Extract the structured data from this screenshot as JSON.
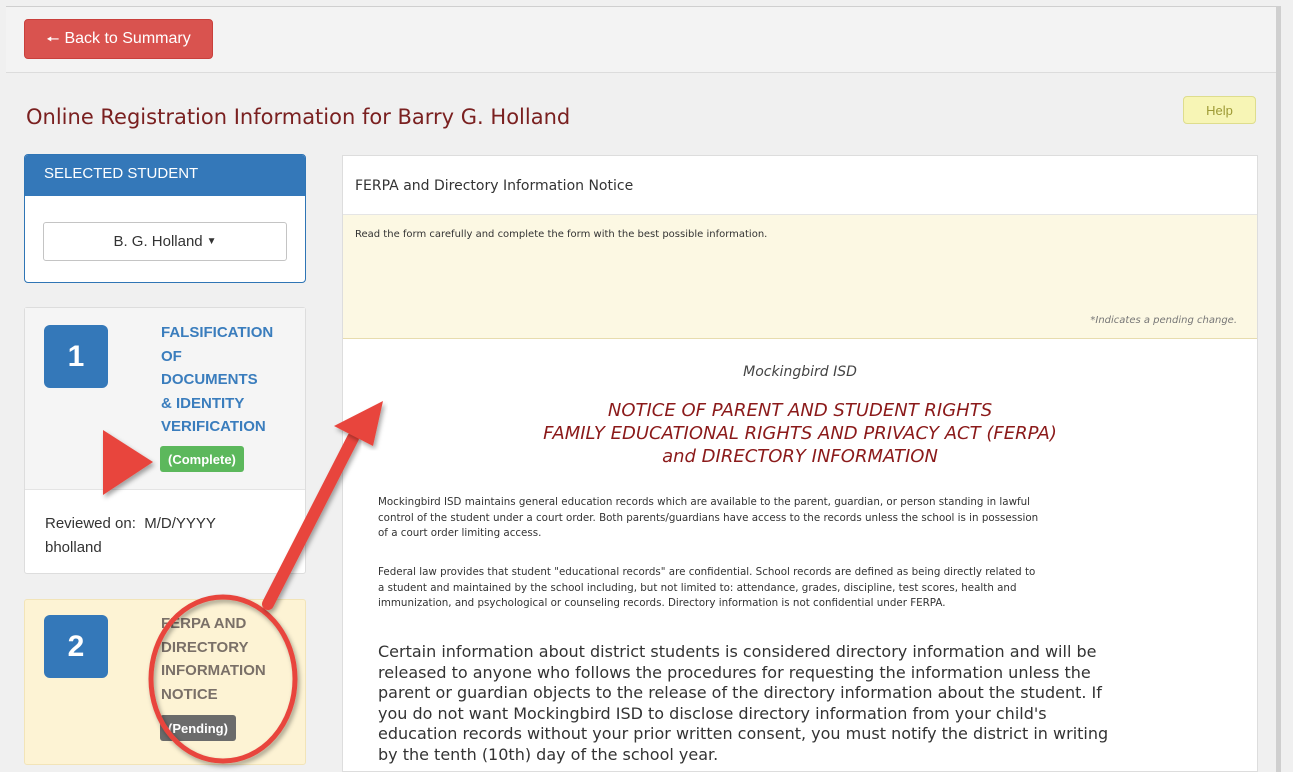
{
  "toolbar": {
    "back_label": "Back to Summary"
  },
  "page": {
    "title": "Online Registration Information for Barry G. Holland",
    "help_label": "Help"
  },
  "student_panel": {
    "header": "SELECTED STUDENT",
    "selected": "B. G. Holland"
  },
  "steps": [
    {
      "number": "1",
      "lines": [
        "FALSIFICATION",
        "OF",
        "DOCUMENTS",
        "& IDENTITY",
        "VERIFICATION"
      ],
      "status": "(Complete)",
      "reviewed_label": "Reviewed on:",
      "reviewed_date": "M/D/YYYY",
      "reviewed_by": "bholland"
    },
    {
      "number": "2",
      "lines": [
        "FERPA AND",
        "DIRECTORY",
        "INFORMATION",
        "NOTICE"
      ],
      "status": "(Pending)"
    }
  ],
  "main": {
    "heading": "FERPA and Directory Information Notice",
    "instructions": "Read the form carefully and complete the form with the best possible information.",
    "pending_note": "*Indicates a pending change.",
    "district": "Mockingbird ISD",
    "title_lines": [
      "NOTICE OF PARENT AND STUDENT RIGHTS",
      "FAMILY EDUCATIONAL RIGHTS AND PRIVACY ACT (FERPA)",
      "and DIRECTORY INFORMATION"
    ],
    "para1_lines": [
      "Mockingbird ISD maintains general education records which are available to the parent, guardian, or person standing in lawful",
      "control of the student under a court order. Both parents/guardians have access to the records unless the school is in possession",
      "of a court order limiting access."
    ],
    "para2_lines": [
      "Federal law provides that student \"educational records\" are confidential. School records are defined as being directly related to",
      "a student and maintained by the school including, but not limited to: attendance, grades, discipline, test scores, health and",
      "immunization, and psychological or counseling records. Directory information is not confidential under FERPA."
    ],
    "para3_lines": [
      "Certain information about district students is considered directory information and will be",
      "released to anyone who follows the procedures for requesting the information unless the",
      "parent or guardian objects to the release of the directory information about the student. If",
      "you do not want Mockingbird ISD to disclose directory information from your child's",
      "education records without your prior written consent, you must notify the district in writing",
      "by the tenth (10th) day of the school year."
    ]
  },
  "colors": {
    "back_button": "#d9534f",
    "primary_blue": "#3478b9",
    "complete_green": "#5cb85c",
    "pending_gray": "#6b6b6b",
    "notice_title_red": "#8b1a1a",
    "annotation_red": "#e8453c",
    "notice_bg": "#fcf8e3"
  }
}
